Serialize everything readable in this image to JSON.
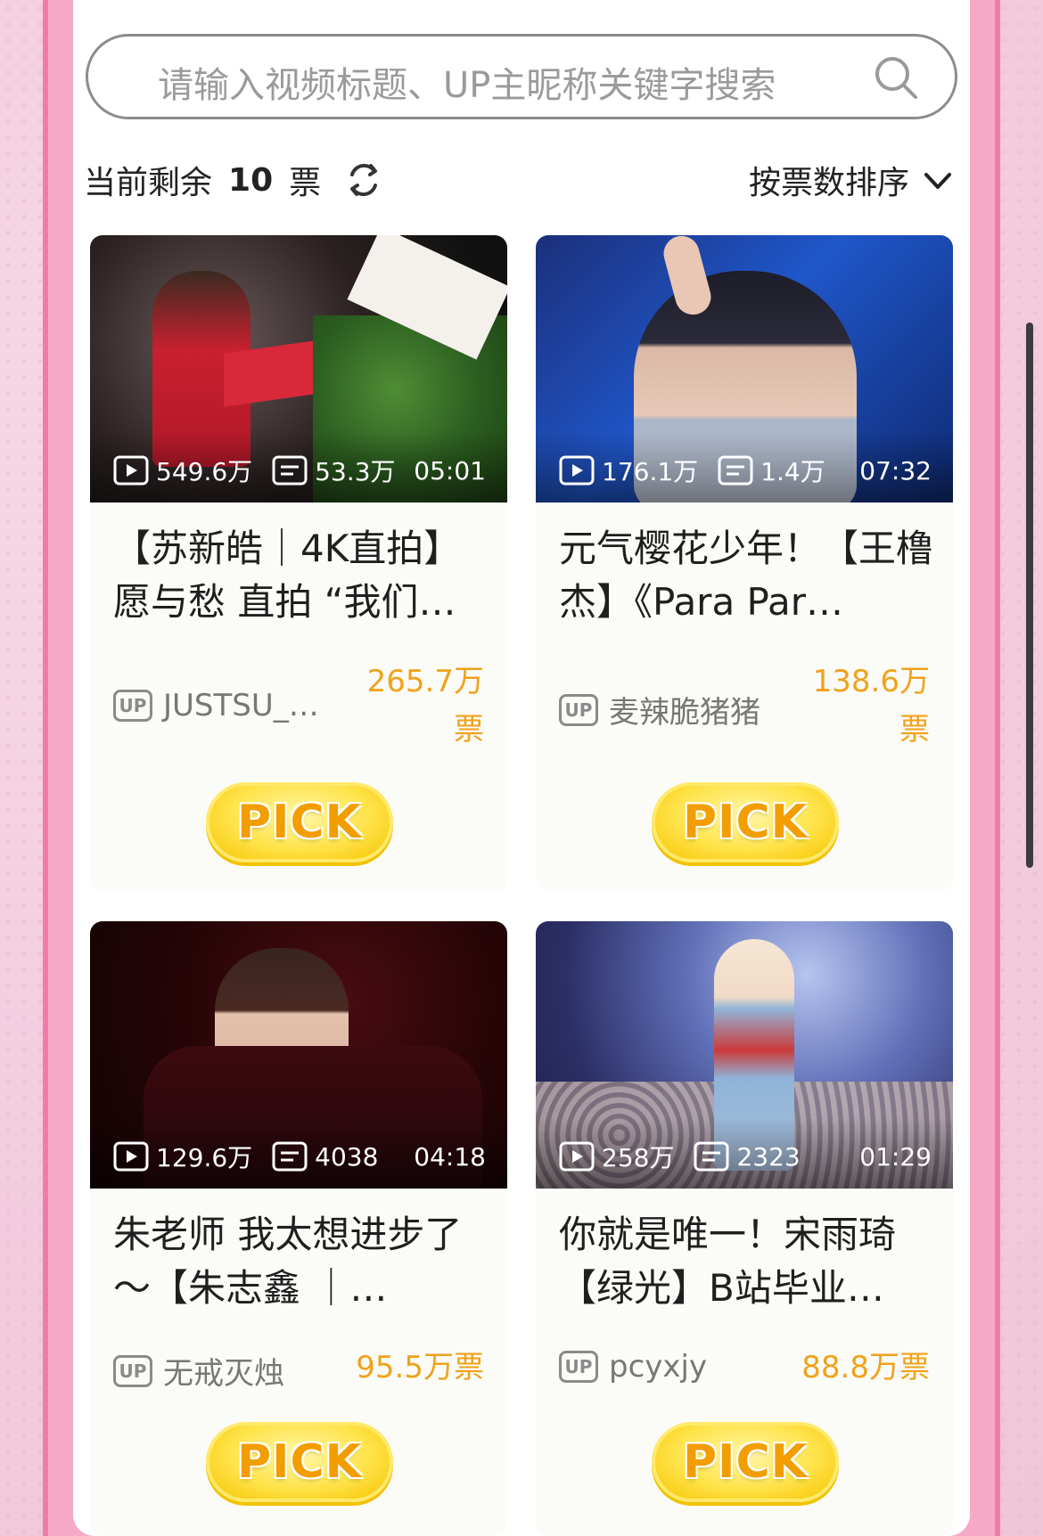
{
  "search": {
    "placeholder": "请输入视频标题、UP主昵称关键字搜索"
  },
  "votes": {
    "prefix": "当前剩余",
    "count": "10",
    "unit": "票"
  },
  "sort": {
    "label": "按票数排序"
  },
  "pick_label": "PICK",
  "colors": {
    "accent_pink": "#f27aa9",
    "vote_orange": "#f0a21a",
    "pick_yellow": "#ffe34a"
  },
  "cards": [
    {
      "views": "549.6万",
      "danmaku": "53.3万",
      "duration": "05:01",
      "title": "【苏新皓｜4K直拍】愿与愁 直拍 “我们…",
      "uploader": "JUSTSU_…",
      "count_line1": "265.7万",
      "count_line2": "票",
      "up_badge": "UP"
    },
    {
      "views": "176.1万",
      "danmaku": "1.4万",
      "duration": "07:32",
      "title": "元气樱花少年！【王橹杰】《Para Par…",
      "uploader": "麦辣脆猪猪",
      "count_line1": "138.6万",
      "count_line2": "票",
      "up_badge": "UP"
    },
    {
      "views": "129.6万",
      "danmaku": "4038",
      "duration": "04:18",
      "title": "朱老师 我太想进步了～【朱志鑫 ｜…",
      "uploader": "无戒灭烛",
      "count_line1": "95.5万票",
      "count_line2": "",
      "up_badge": "UP"
    },
    {
      "views": "258万",
      "danmaku": "2323",
      "duration": "01:29",
      "title": "你就是唯一！宋雨琦【绿光】B站毕业…",
      "uploader": "pcyxjy",
      "count_line1": "88.8万票",
      "count_line2": "",
      "up_badge": "UP"
    }
  ]
}
